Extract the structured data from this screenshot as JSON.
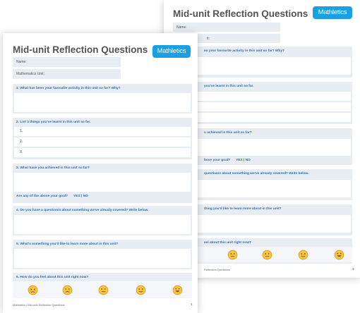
{
  "worksheet": {
    "title": "Mid-unit Reflection Questions",
    "logo_text": "Mathletics",
    "fields": {
      "name": "Name:",
      "unit": "Mathematics Unit:"
    },
    "questions": {
      "q1": "1. What has been your favourite activity in this unit so far? Why?",
      "q2": "2. List 3 things you've learnt in this unit so far.",
      "q3": "3. What have you achieved in this unit so far?",
      "q4": "4. Do you have a question/s about something we've already covered? Write below.",
      "q5": "5. What's something you'd like to learn more about in this unit?",
      "q6": "6. How do you feel about this unit right now?"
    },
    "list_numbers": [
      "1.",
      "2.",
      "3."
    ],
    "goal_question": "Are any of the above your goal?",
    "goal_yes": "YES",
    "goal_sep": "|",
    "goal_no": "NO",
    "footer": "Mathletics | Mid-unit Reflection Questions",
    "page_number": "1"
  },
  "back_sheet": {
    "name_field": "Name:",
    "unit_field_fragment": "it:",
    "q1_fragment": "en your favourite activity in this unit so far? Why?",
    "q2_fragment": "you've learnt in this unit so far.",
    "q3_fragment": "u achieved in this unit so far?",
    "goal_fragment": "bove your goal?",
    "goal_yes": "YES",
    "goal_sep": "|",
    "goal_no": "NO",
    "q4_fragment": "question/s about something we've already covered? Write below.",
    "q5_fragment": "thing you'd like to learn more about in this unit?",
    "q6_fragment": "eel about this unit right now?",
    "footer_fragment": "Reflection Questions",
    "page_number": "1"
  },
  "faces": [
    "crying-face",
    "sad-face",
    "neutral-face",
    "smiling-face",
    "grinning-face"
  ],
  "colors": {
    "brand_blue": "#1aa0e0",
    "label_blue": "#2a6eb8",
    "box_grey": "#e8ecf3",
    "face_yellow": "#f7c342",
    "face_outline": "#e0a020"
  }
}
